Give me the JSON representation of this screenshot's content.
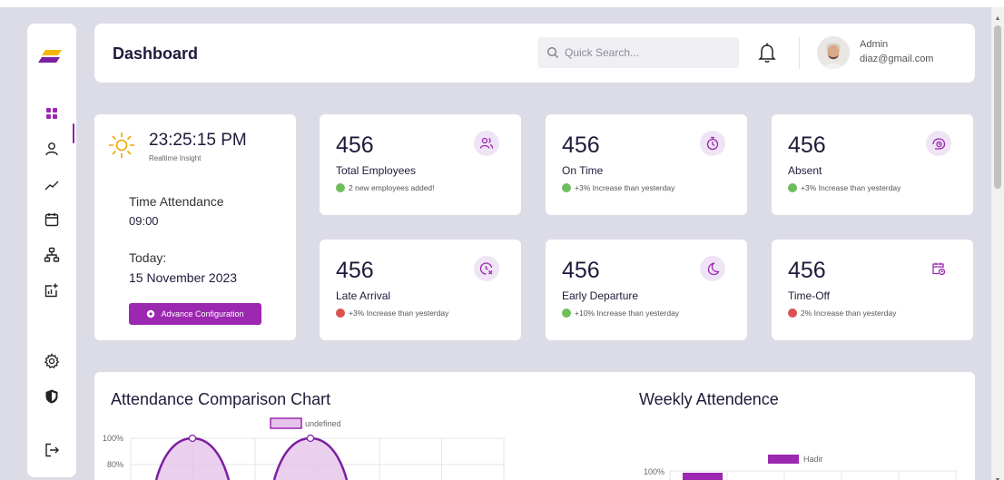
{
  "header": {
    "title": "Dashboard",
    "search_placeholder": "Quick Search...",
    "user": {
      "name": "Admin",
      "email": "diaz@gmail.com"
    }
  },
  "sidebar": {
    "items": [
      {
        "icon": "grid-icon",
        "active": true
      },
      {
        "icon": "user-icon"
      },
      {
        "icon": "trend-icon"
      },
      {
        "icon": "calendar-icon"
      },
      {
        "icon": "org-chart-icon"
      },
      {
        "icon": "add-report-icon"
      },
      {
        "icon": "gear-icon"
      },
      {
        "icon": "shield-icon"
      },
      {
        "icon": "logout-icon"
      }
    ]
  },
  "time_card": {
    "clock": "23:25:15 PM",
    "subtitle": "Realtime Insight",
    "attendance_label": "Time Attendance",
    "attendance_time": "09:00",
    "today_label": "Today:",
    "today_date": "15 November 2023",
    "config_button": "Advance Configuration"
  },
  "stats": [
    {
      "value": "456",
      "label": "Total Employees",
      "note": "2 new employees added!",
      "trend": "up",
      "icon": "users-icon"
    },
    {
      "value": "456",
      "label": "On Time",
      "note": "+3% Increase than yesterday",
      "trend": "up",
      "icon": "stopwatch-icon"
    },
    {
      "value": "456",
      "label": "Absent",
      "note": "+3% Increase than yesterday",
      "trend": "up",
      "icon": "clock-circle-icon"
    },
    {
      "value": "456",
      "label": "Late Arrival",
      "note": "+3% Increase than yesterday",
      "trend": "down",
      "icon": "clock-x-icon"
    },
    {
      "value": "456",
      "label": "Early Departure",
      "note": "+10% Increase than yesterday",
      "trend": "up",
      "icon": "moon-icon"
    },
    {
      "value": "456",
      "label": "Time-Off",
      "note": "2% Increase than yesterday",
      "trend": "down",
      "icon": "calendar-clock-icon"
    }
  ],
  "colors": {
    "accent": "#9c27b0",
    "accent_light": "#efe4f5",
    "up": "#6dbf5a",
    "down": "#d9534f",
    "logo_purple": "#7b1fa2",
    "logo_yellow": "#f5b800"
  },
  "charts": {
    "comparison_title": "Attendance Comparison Chart",
    "weekly_title": "Weekly Attendence"
  },
  "chart_data": [
    {
      "type": "area",
      "title": "Attendance Comparison Chart",
      "legend": [
        "undefined"
      ],
      "legend_position": "top",
      "y_ticks": [
        "100%",
        "80%"
      ],
      "grid": true,
      "visible_peaks": [
        100,
        100
      ]
    },
    {
      "type": "bar",
      "title": "Weekly Attendence",
      "legend": [
        "Hadir"
      ],
      "legend_position": "top",
      "y_ticks": [
        "100%"
      ],
      "grid": true
    }
  ]
}
